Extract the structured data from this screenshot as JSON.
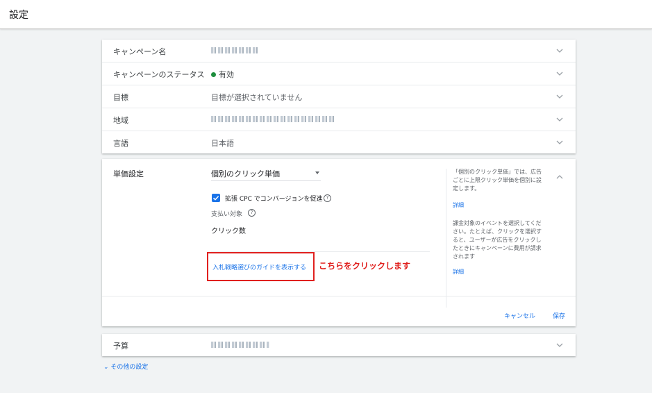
{
  "header": {
    "title": "設定"
  },
  "settings": {
    "campaign_name": {
      "label": "キャンペーン名"
    },
    "campaign_status": {
      "label": "キャンペーンのステータス",
      "value": "有効",
      "status_color": "#1e8e3e"
    },
    "goal": {
      "label": "目標",
      "value": "目標が選択されていません"
    },
    "location": {
      "label": "地域"
    },
    "language": {
      "label": "言語",
      "value": "日本語"
    }
  },
  "bidding": {
    "label": "単価設定",
    "strategy": "個別のクリック単価",
    "enhanced_cpc": {
      "label": "拡張 CPC でコンバージョンを促進",
      "checked": true
    },
    "pay_for_label": "支払い対象",
    "pay_for_value": "クリック数",
    "guide_link": "入札戦略選びのガイドを表示する",
    "annotation": "こちらをクリックします",
    "help_icon_glyph": "?",
    "side": {
      "text1": "「個別のクリック単価」では、広告ごとに上限クリック単価を個別に設定します。",
      "link1": "詳細",
      "text2": "課金対象のイベントを選択してください。たとえば、クリックを選択すると、ユーザーが広告をクリックしたときにキャンペーンに費用が請求されます",
      "link2": "詳細"
    },
    "cancel": "キャンセル",
    "save": "保存"
  },
  "budget": {
    "label": "予算"
  },
  "more_settings": "⌄ その他の設定",
  "colors": {
    "accent": "#1a73e8",
    "highlight": "#e0201e"
  },
  "icons": [
    "chevron-down-icon",
    "chevron-up-icon",
    "checkbox-checked-icon",
    "help-icon",
    "caret-down-icon"
  ]
}
